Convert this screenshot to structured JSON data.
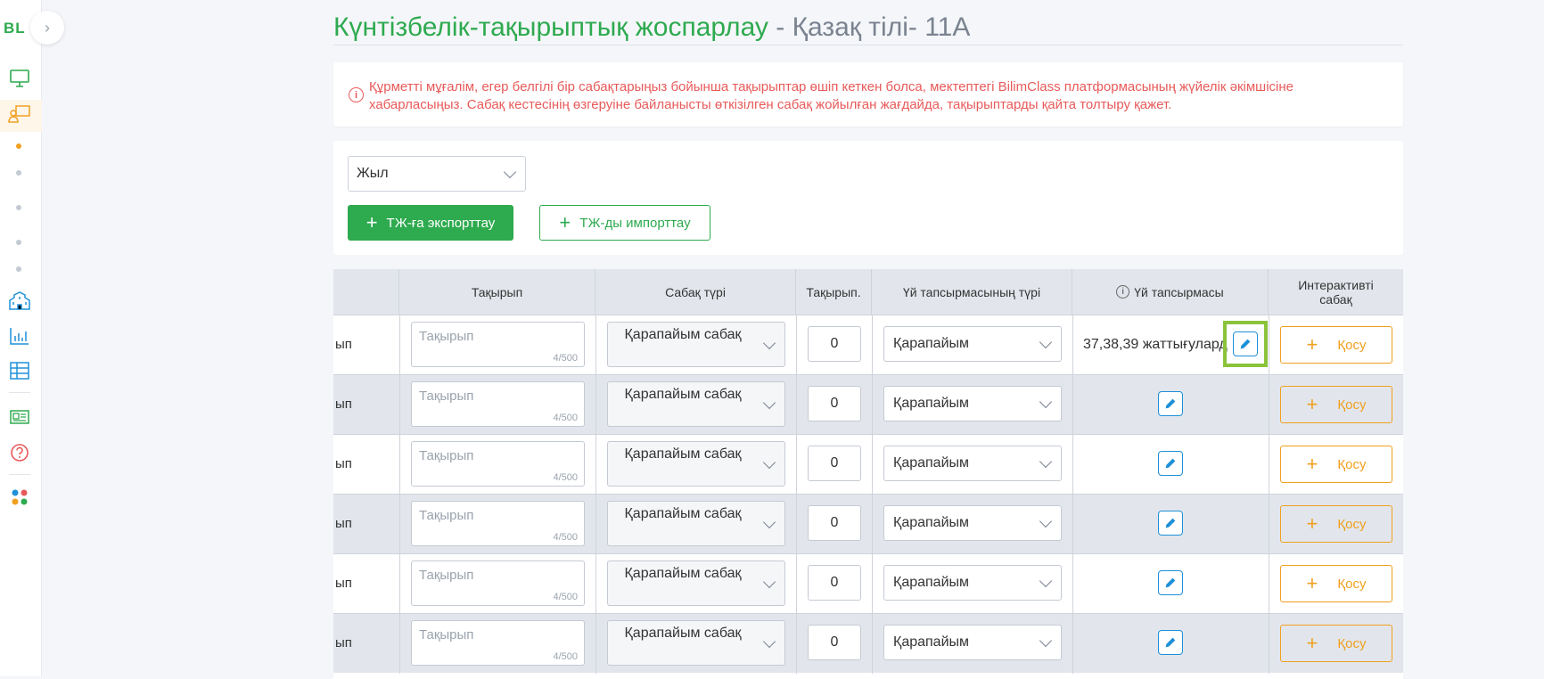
{
  "sidebar": {
    "logo": "BL",
    "collapse_icon": "chevron-right-icon",
    "icons": [
      "monitor-icon",
      "teacher-board-icon",
      "school-building-icon",
      "bar-chart-icon",
      "table-icon",
      "id-card-icon",
      "help-icon",
      "apps-grid-icon"
    ]
  },
  "header": {
    "title_main": "Күнтізбелік-тақырыптық жоспарлау",
    "title_sub": " - Қазақ тілі- 11А"
  },
  "alert": {
    "icon": "info-icon",
    "text": "Құрметті мұғалім, егер белгілі бір сабақтарыңыз бойынша тақырыптар өшіп кеткен болса, мектептегі BilimClass платформасының жүйелік әкімшісіне хабарласыңыз. Сабақ кестесінің өзгеруіне байланысты өткізілген сабақ жойылған жағдайда, тақырыптарды қайта толтыру қажет."
  },
  "filters": {
    "year_select": "Жыл",
    "export_label": "ТЖ-ға экспорттау",
    "import_label": "ТЖ-ды импорттау"
  },
  "table": {
    "columns": [
      "Тақырып",
      "Сабақ түрі",
      "Тақырып.",
      "Үй тапсырмасының түрі",
      "Үй тапсырмасы",
      "Интерактивті сабақ"
    ],
    "rows": [
      {
        "first": "ып",
        "topic_placeholder": "Тақырып",
        "topic_count": "4/500",
        "lesson_type": "Қарапайым сабақ",
        "topic_num": "0",
        "hw_type": "Қарапайым",
        "homework": "37,38,39 жаттығулард",
        "add_label": "Қосу"
      },
      {
        "first": "ып",
        "topic_placeholder": "Тақырып",
        "topic_count": "4/500",
        "lesson_type": "Қарапайым сабақ",
        "topic_num": "0",
        "hw_type": "Қарапайым",
        "homework": "",
        "add_label": "Қосу"
      },
      {
        "first": "ып",
        "topic_placeholder": "Тақырып",
        "topic_count": "4/500",
        "lesson_type": "Қарапайым сабақ",
        "topic_num": "0",
        "hw_type": "Қарапайым",
        "homework": "",
        "add_label": "Қосу"
      },
      {
        "first": "ып",
        "topic_placeholder": "Тақырып",
        "topic_count": "4/500",
        "lesson_type": "Қарапайым сабақ",
        "topic_num": "0",
        "hw_type": "Қарапайым",
        "homework": "",
        "add_label": "Қосу"
      },
      {
        "first": "ып",
        "topic_placeholder": "Тақырып",
        "topic_count": "4/500",
        "lesson_type": "Қарапайым сабақ",
        "topic_num": "0",
        "hw_type": "Қарапайым",
        "homework": "",
        "add_label": "Қосу"
      },
      {
        "first": "ып",
        "topic_placeholder": "Тақырып",
        "topic_count": "4/500",
        "lesson_type": "Қарапайым сабақ",
        "topic_num": "0",
        "hw_type": "Қарапайым",
        "homework": "",
        "add_label": "Қосу"
      }
    ]
  },
  "colors": {
    "brand_green": "#2eaa4f",
    "alert_red": "#e85a5a",
    "accent_orange": "#f0a020",
    "edit_blue": "#1e90d8",
    "highlight_lime": "#8bc33a"
  }
}
